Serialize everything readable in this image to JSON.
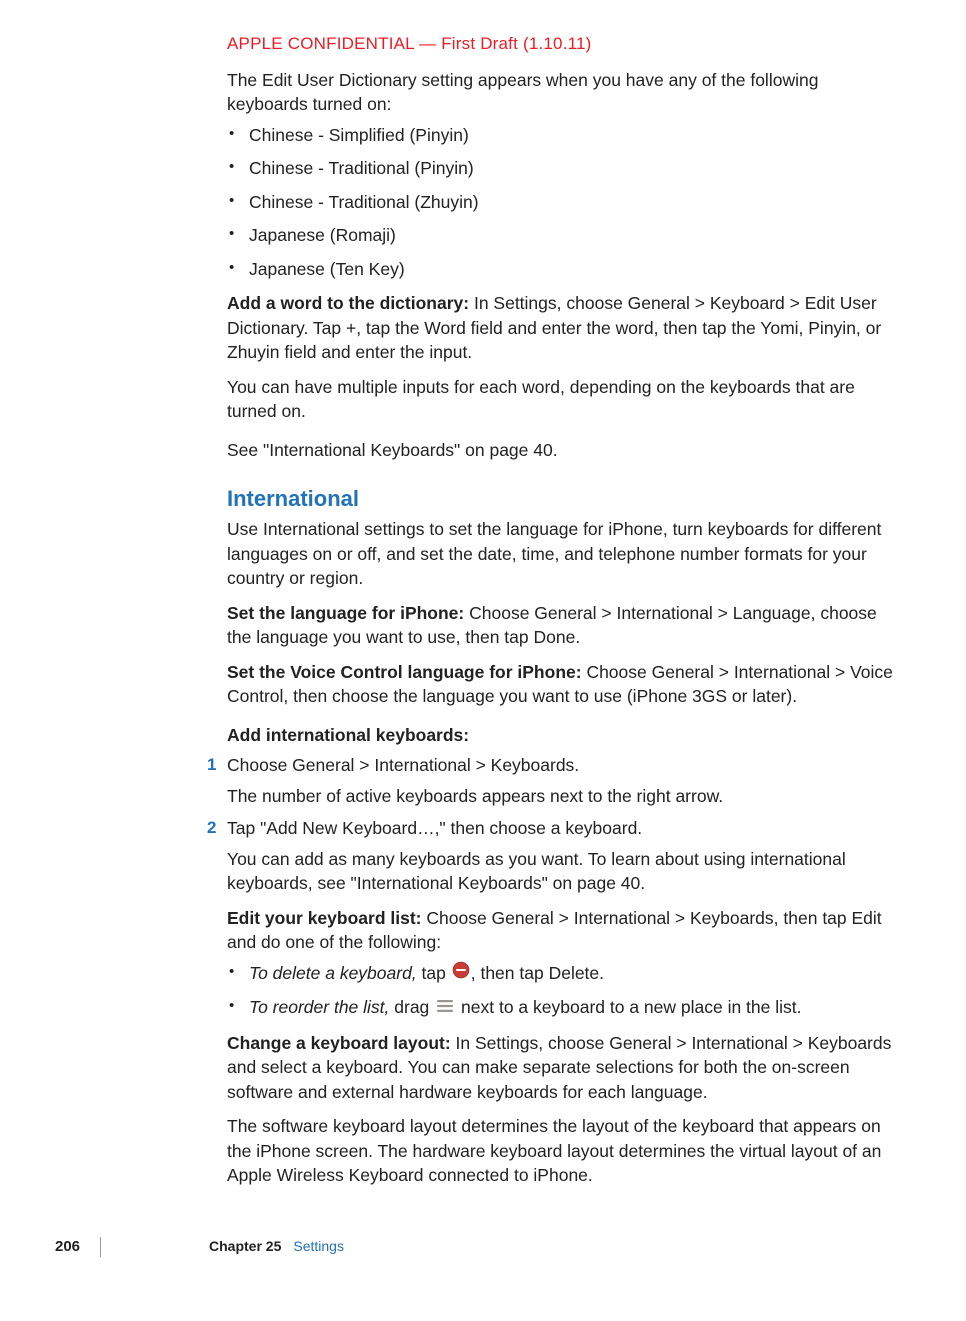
{
  "header": {
    "confidential": "APPLE CONFIDENTIAL — First Draft (1.10.11)"
  },
  "intro": {
    "p1": "The Edit User Dictionary setting appears when you have any of the following keyboards turned on:",
    "bullets": [
      "Chinese - Simplified (Pinyin)",
      "Chinese - Traditional (Pinyin)",
      "Chinese - Traditional (Zhuyin)",
      "Japanese (Romaji)",
      "Japanese (Ten Key)"
    ],
    "addWord": {
      "label": "Add a word to the dictionary:  ",
      "text": "In Settings, choose General > Keyboard > Edit User Dictionary. Tap +, tap the Word field and enter the word, then tap the Yomi, Pinyin, or Zhuyin field and enter the input."
    },
    "p2": "You can have multiple inputs for each word, depending on the keyboards that are turned on.",
    "p3": "See \"International Keyboards\" on page 40."
  },
  "international": {
    "heading": "International",
    "p1": "Use International settings to set the language for iPhone, turn keyboards for different languages on or off, and set the date, time, and telephone number formats for your country or region.",
    "setLang": {
      "label": "Set the language for iPhone:  ",
      "text": "Choose General > International > Language, choose the language you want to use, then tap Done."
    },
    "setVoice": {
      "label": "Set the Voice Control language for iPhone:  ",
      "text": "Choose General > International > Voice Control, then choose the language you want to use (iPhone 3GS or later)."
    },
    "addKb": {
      "label": "Add international keyboards:"
    },
    "steps": [
      {
        "num": "1",
        "text": "Choose General > International > Keyboards.",
        "sub": "The number of active keyboards appears next to the right arrow."
      },
      {
        "num": "2",
        "text": "Tap \"Add New Keyboard…,\" then choose a keyboard.",
        "sub": "You can add as many keyboards as you want. To learn about using international keyboards, see \"International Keyboards\" on page 40."
      }
    ],
    "editList": {
      "label": "Edit your keyboard list:  ",
      "text": "Choose General > International > Keyboards, then tap Edit and do one of the following:"
    },
    "editBullets": [
      {
        "italic": "To delete a keyboard, ",
        "pre": "tap ",
        "post": ", then tap Delete."
      },
      {
        "italic": "To reorder the list, ",
        "pre": "drag ",
        "post": " next to a keyboard to a new place in the list."
      }
    ],
    "changeLayout": {
      "label": "Change a keyboard layout:  ",
      "text": "In Settings, choose General > International > Keyboards and select a keyboard. You can make separate selections for both the on-screen software and external hardware keyboards for each language."
    },
    "p2": "The software keyboard layout determines the layout of the keyboard that appears on the iPhone screen. The hardware keyboard layout determines the virtual layout of an Apple Wireless Keyboard connected to iPhone."
  },
  "footer": {
    "pageNum": "206",
    "chapterLabel": "Chapter 25",
    "chapterName": "Settings"
  }
}
